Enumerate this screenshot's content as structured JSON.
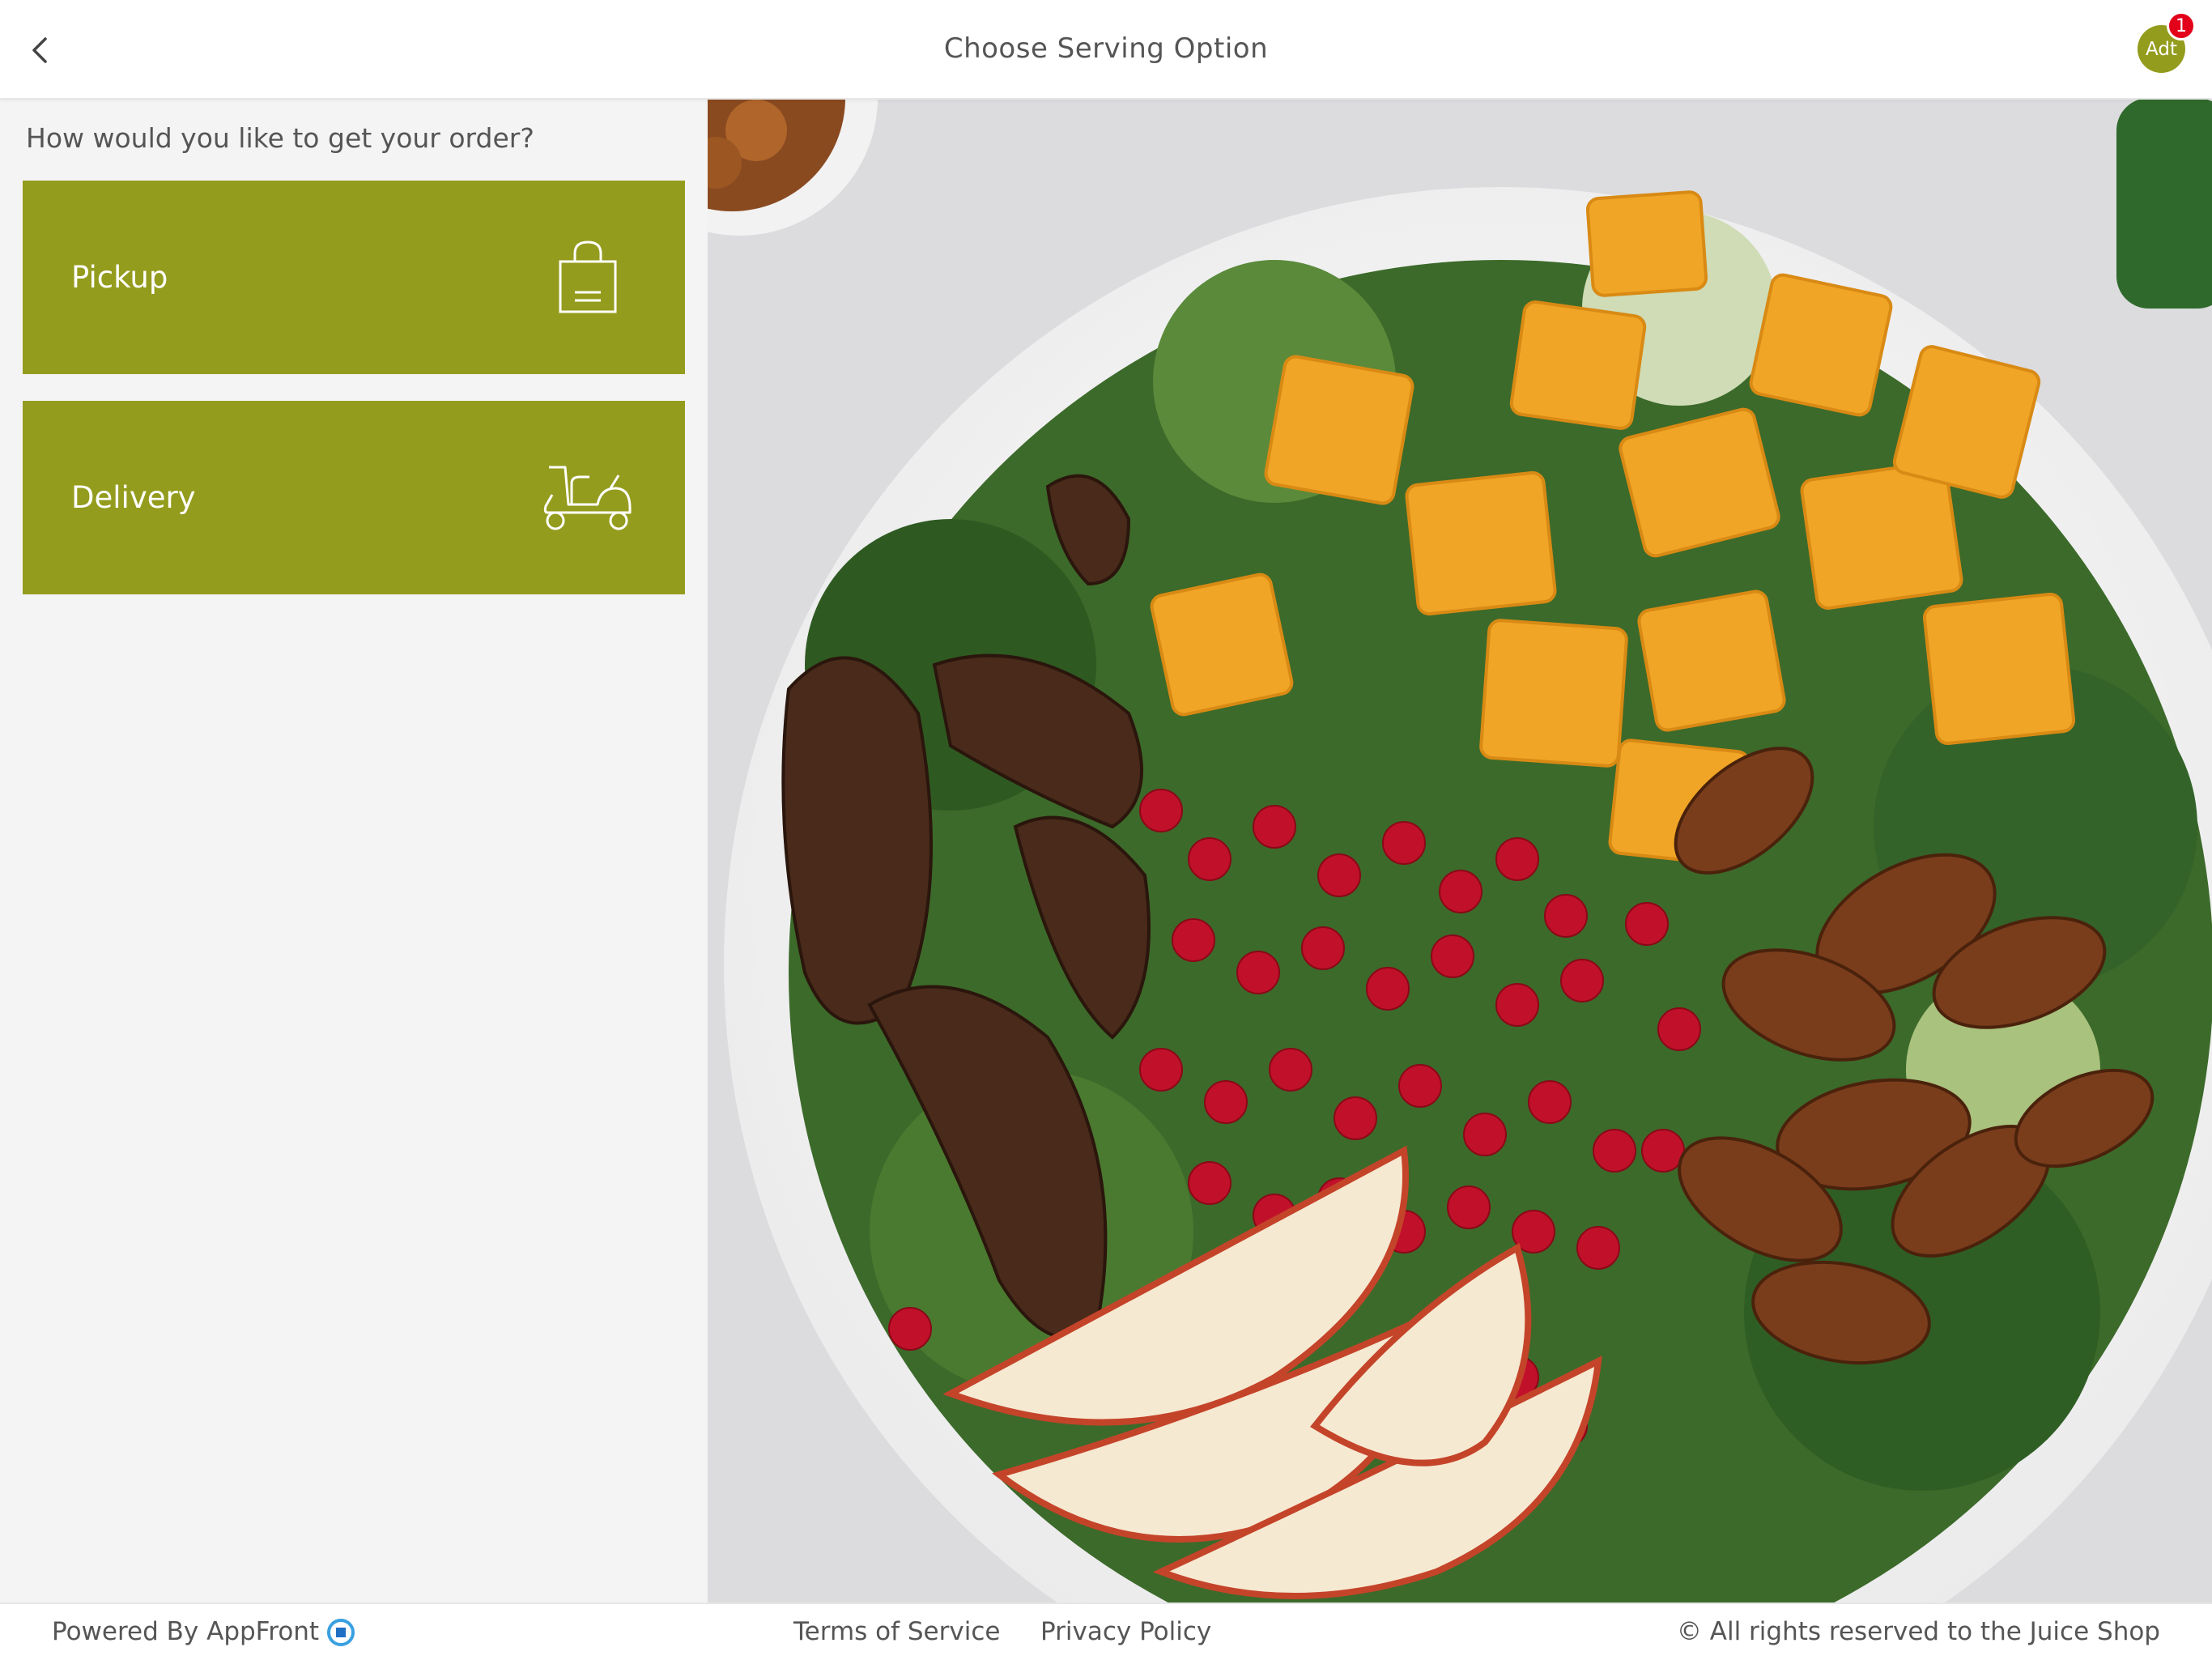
{
  "header": {
    "title": "Choose Serving Option",
    "back_icon": "chevron-left-icon",
    "avatar_initials": "Adt",
    "cart_count": "1"
  },
  "main": {
    "question": "How would you like to get your order?",
    "options": [
      {
        "label": "Pickup",
        "icon": "shopping-bag-icon"
      },
      {
        "label": "Delivery",
        "icon": "scooter-icon"
      }
    ]
  },
  "footer": {
    "powered_by": "Powered By AppFront",
    "terms": "Terms of Service",
    "privacy": "Privacy Policy",
    "copyright": "© All rights reserved to the Juice Shop"
  },
  "colors": {
    "accent": "#949c1d",
    "badge": "#e2001a",
    "background": "#f4f4f4",
    "header_bg": "#ffffff",
    "text": "#555555"
  }
}
